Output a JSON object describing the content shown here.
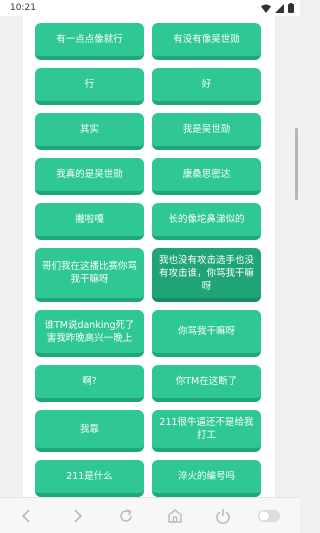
{
  "status": {
    "time": "10:21"
  },
  "buttons": [
    {
      "label": "有一点点像就行",
      "pressed": false
    },
    {
      "label": "有没有像吴世勋",
      "pressed": false
    },
    {
      "label": "行",
      "pressed": false
    },
    {
      "label": "好",
      "pressed": false
    },
    {
      "label": "其实",
      "pressed": false
    },
    {
      "label": "我是吴世勋",
      "pressed": false
    },
    {
      "label": "我真的是吴世勋",
      "pressed": false
    },
    {
      "label": "康桑思密达",
      "pressed": false
    },
    {
      "label": "撇啦嘎",
      "pressed": false
    },
    {
      "label": "长的像坨鼻涕似的",
      "pressed": false
    },
    {
      "label": "哥们我在这播比赛你骂我干嘛呀",
      "pressed": false
    },
    {
      "label": "我也没有攻击选手也没有攻击谁，你骂我干嘛呀",
      "pressed": true
    },
    {
      "label": "谁TM说danking死了害我昨晚高兴一晚上",
      "pressed": false
    },
    {
      "label": "你骂我干嘛呀",
      "pressed": false
    },
    {
      "label": "啊?",
      "pressed": false
    },
    {
      "label": "你TM在这断了",
      "pressed": false
    },
    {
      "label": "我靠",
      "pressed": false
    },
    {
      "label": "211很牛逼还不是给我打工",
      "pressed": false
    },
    {
      "label": "211是什么",
      "pressed": false
    },
    {
      "label": "淬火的编号吗",
      "pressed": false
    }
  ],
  "icons": {
    "back": "chevron-left-icon",
    "forward": "chevron-right-icon",
    "refresh": "refresh-icon",
    "home": "home-icon",
    "power": "power-icon",
    "toggle": "toggle-switch"
  },
  "colors": {
    "button": "#2ec795",
    "button_shadow": "#1ea77a",
    "button_pressed": "#1fa478"
  }
}
